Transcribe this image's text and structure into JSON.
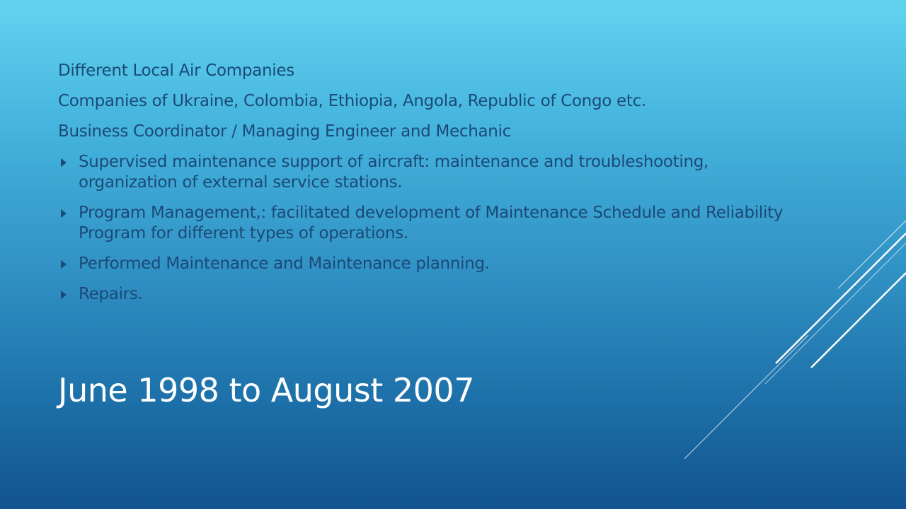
{
  "slide": {
    "lines": [
      "Different Local Air Companies",
      "Companies of Ukraine, Colombia, Ethiopia, Angola, Republic of Congo etc.",
      "Business Coordinator / Managing Engineer and Mechanic"
    ],
    "bullets": [
      "Supervised maintenance support of aircraft: maintenance and troubleshooting, organization of external service stations.",
      "Program Management,: facilitated development of Maintenance Schedule and Reliability Program for different types of operations.",
      "Performed Maintenance and Maintenance planning.",
      "Repairs."
    ],
    "title": "June 1998 to August 2007"
  },
  "colors": {
    "background_top": "#62d3ef",
    "background_bottom": "#12548f",
    "body_text": "#1b4a76",
    "title_text": "#ffffff",
    "decor_lines": "#ffffff"
  }
}
